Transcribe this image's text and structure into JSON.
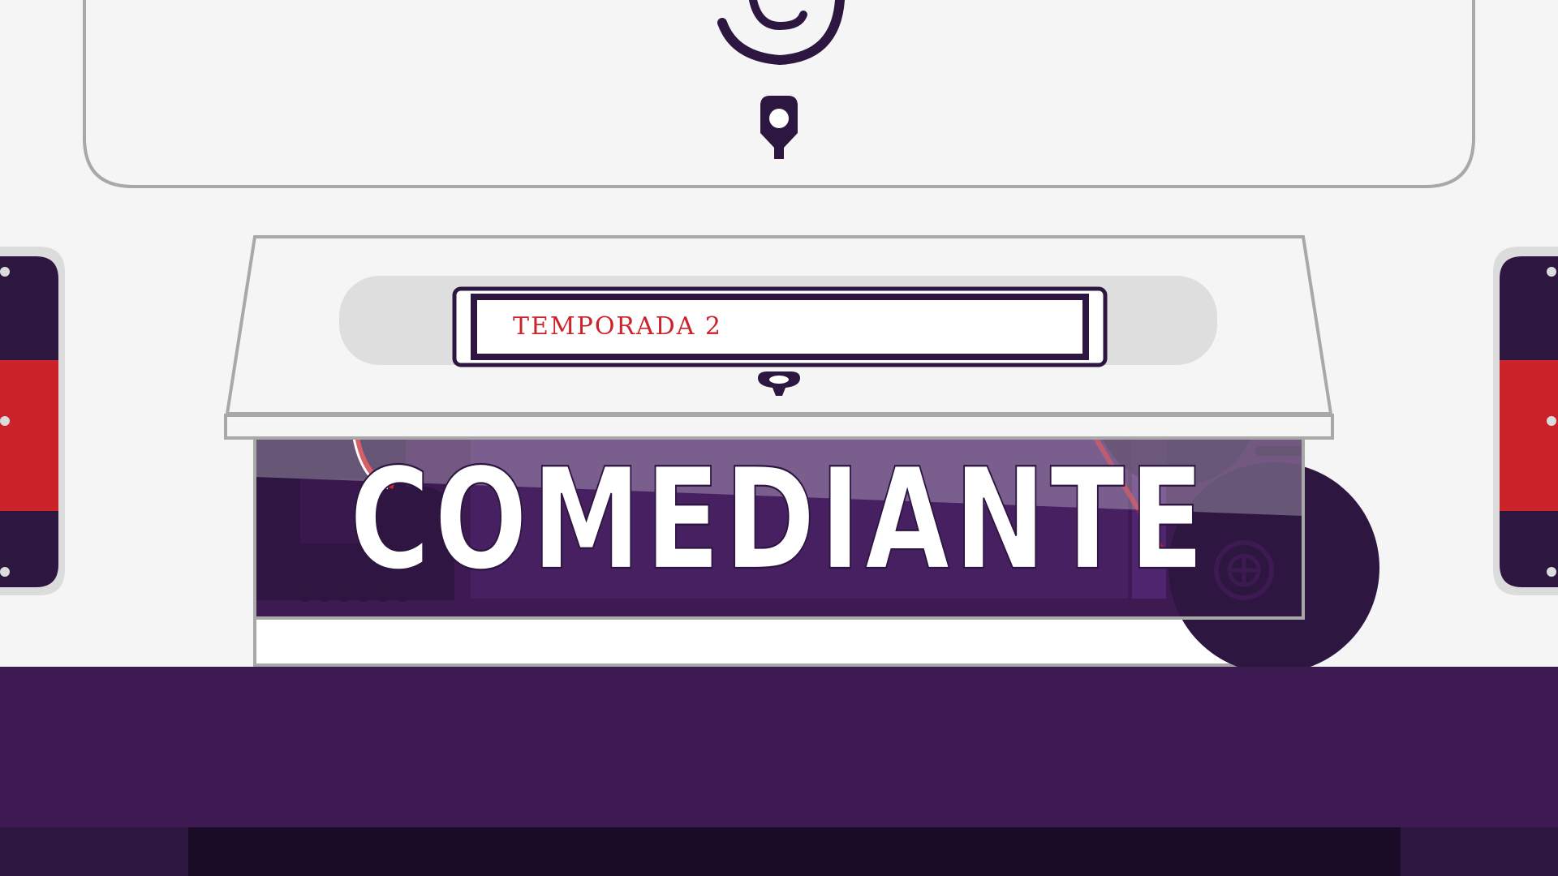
{
  "colors": {
    "background": "#f5f5f5",
    "outline": "#a8a8a8",
    "dark_purple": "#2d1640",
    "purple": "#3d1a52",
    "panel_purple": "#4a2266",
    "red": "#cc2229",
    "white": "#ffffff",
    "sign_gray": "#dedede",
    "black_strip": "#1a0c26"
  },
  "label_strip": {
    "text": "TEMPORADA 2"
  },
  "title_sign": {
    "text": "COMEDIANTE"
  },
  "icons": {
    "top_hook": "hook-icon",
    "pin": "pin-icon",
    "small_knob": "knob-icon",
    "film_reel": "reel-icon"
  }
}
